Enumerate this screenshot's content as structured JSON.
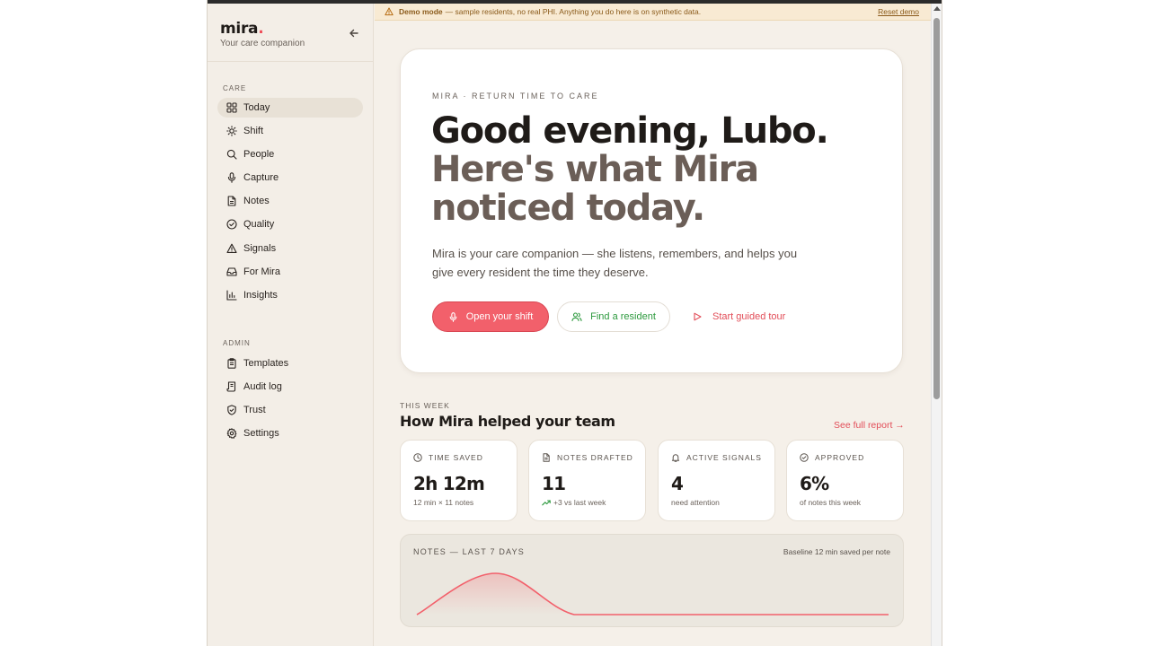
{
  "brand": {
    "name": "mira",
    "dot": ".",
    "tagline": "Your care companion"
  },
  "banner": {
    "bold": "Demo mode",
    "text": "— sample residents, no real PHI. Anything you do here is on synthetic data.",
    "reset": "Reset demo"
  },
  "sidebar": {
    "care_label": "CARE",
    "admin_label": "ADMIN",
    "care_items": [
      {
        "label": "Today",
        "icon": "grid-icon",
        "active": true
      },
      {
        "label": "Shift",
        "icon": "sun-icon"
      },
      {
        "label": "People",
        "icon": "search-icon"
      },
      {
        "label": "Capture",
        "icon": "microphone-icon"
      },
      {
        "label": "Notes",
        "icon": "document-icon"
      },
      {
        "label": "Quality",
        "icon": "check-circle-icon"
      },
      {
        "label": "Signals",
        "icon": "warning-icon"
      },
      {
        "label": "For Mira",
        "icon": "inbox-icon"
      },
      {
        "label": "Insights",
        "icon": "bar-chart-icon"
      }
    ],
    "admin_items": [
      {
        "label": "Templates",
        "icon": "clipboard-icon"
      },
      {
        "label": "Audit log",
        "icon": "scroll-icon"
      },
      {
        "label": "Trust",
        "icon": "shield-icon"
      },
      {
        "label": "Settings",
        "icon": "gear-icon"
      }
    ]
  },
  "hero": {
    "eyebrow": "MIRA · RETURN TIME TO CARE",
    "greeting": "Good evening, Lubo.",
    "subgreeting": "Here's what Mira noticed today.",
    "lede": "Mira is your care companion — she listens, remembers, and helps you give every resident the time they deserve.",
    "primary_cta": "Open your shift",
    "secondary_cta": "Find a resident",
    "tertiary_cta": "Start guided tour"
  },
  "week": {
    "label": "THIS WEEK",
    "title": "How Mira helped your team",
    "report_link": "See full report →",
    "stats": [
      {
        "label": "TIME SAVED",
        "icon": "clock-icon",
        "value": "2h 12m",
        "sub": "12 min × 11 notes"
      },
      {
        "label": "NOTES DRAFTED",
        "icon": "document-icon",
        "value": "11",
        "sub": "+3 vs last week",
        "trend": "up"
      },
      {
        "label": "ACTIVE SIGNALS",
        "icon": "bell-icon",
        "value": "4",
        "sub": "need attention"
      },
      {
        "label": "APPROVED",
        "icon": "check-circle-icon",
        "value": "6%",
        "sub": "of notes this week"
      }
    ]
  },
  "chart_data": {
    "type": "area",
    "title": "NOTES — LAST 7 DAYS",
    "note": "Baseline 12 min saved per note",
    "x": [
      1,
      2,
      3,
      4,
      5,
      6,
      7
    ],
    "values": [
      0,
      11,
      0,
      0,
      0,
      0,
      0
    ],
    "color": "#f2606b"
  }
}
